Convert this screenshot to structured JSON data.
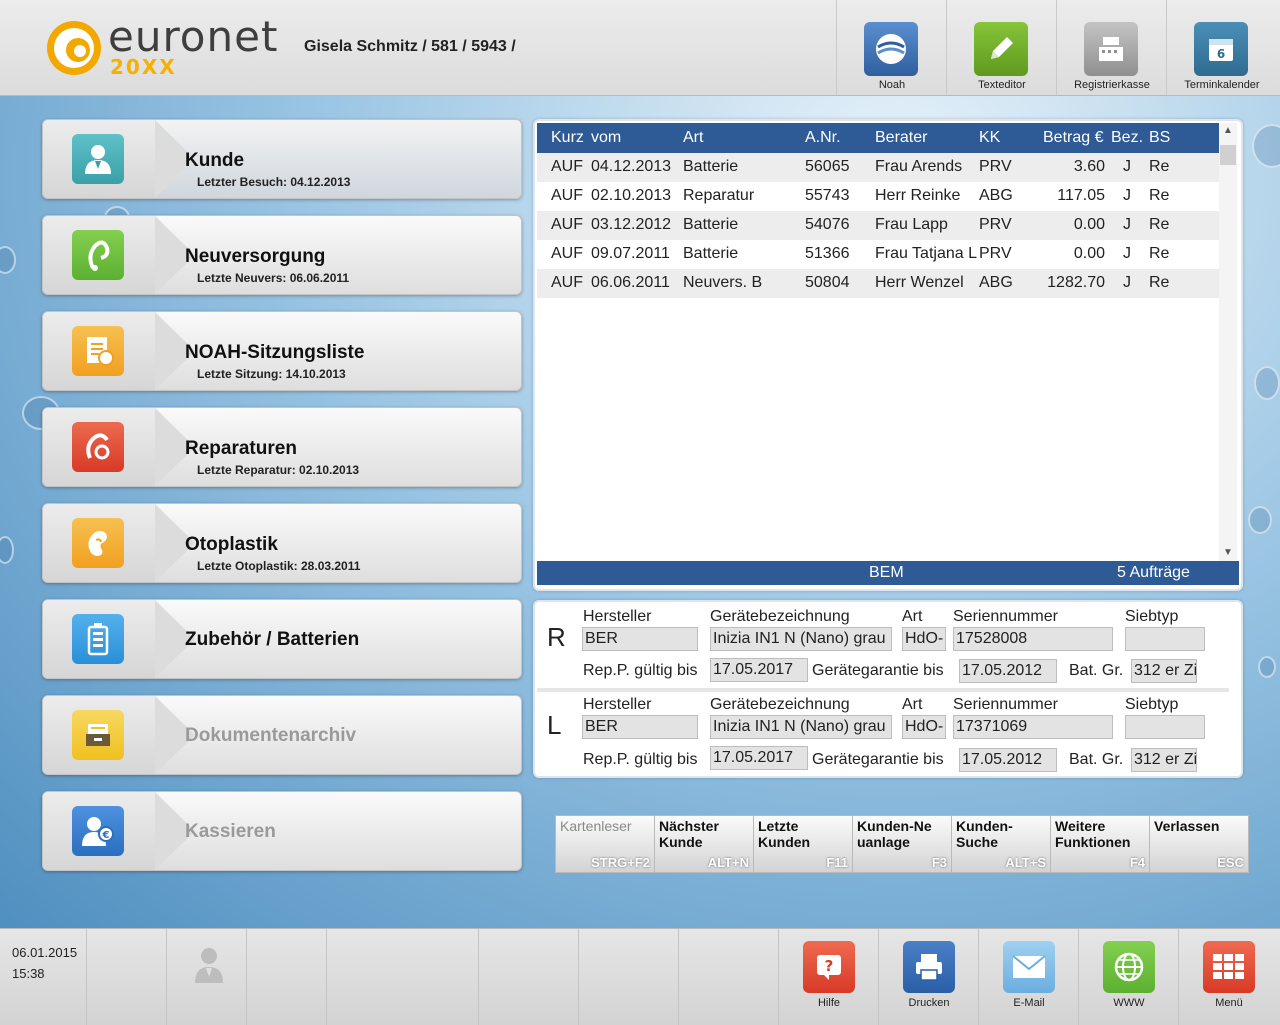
{
  "app": {
    "brand": "euronet",
    "brand_sub": "20XX",
    "customer_line": "Gisela Schmitz / 581 / 5943 /"
  },
  "toolbar": [
    {
      "label": "Noah",
      "icon": "noah-icon",
      "color": "#2f5f9e"
    },
    {
      "label": "Texteditor",
      "icon": "pencil-icon",
      "color": "#5f9a1e"
    },
    {
      "label": "Registrierkasse",
      "icon": "cash-register-icon",
      "color": "#8f8f8f"
    },
    {
      "label": "Terminkalender",
      "icon": "calendar-icon",
      "color": "#2f6b8f"
    }
  ],
  "menu": [
    {
      "title": "Kunde",
      "sub": "Letzter Besuch: 04.12.2013",
      "icon": "customer-icon",
      "color": "#3aa0a8",
      "enabled": true
    },
    {
      "title": "Neuversorgung",
      "sub": "Letzte Neuvers: 06.06.2011",
      "icon": "hearing-aid-icon",
      "color": "#5cb030",
      "enabled": true
    },
    {
      "title": "NOAH-Sitzungsliste",
      "sub": "Letzte Sitzung: 14.10.2013",
      "icon": "session-list-icon",
      "color": "#f0a020",
      "enabled": true
    },
    {
      "title": "Reparaturen",
      "sub": "Letzte Reparatur: 02.10.2013",
      "icon": "repair-icon",
      "color": "#d83a26",
      "enabled": true
    },
    {
      "title": "Otoplastik",
      "sub": "Letzte Otoplastik: 28.03.2011",
      "icon": "ear-mould-icon",
      "color": "#f0a020",
      "enabled": true
    },
    {
      "title": "Zubehör / Batterien",
      "sub": "",
      "icon": "battery-icon",
      "color": "#2a8fd8",
      "enabled": true
    },
    {
      "title": "Dokumentenarchiv",
      "sub": "",
      "icon": "archive-icon",
      "color": "#f0c020",
      "enabled": false
    },
    {
      "title": "Kassieren",
      "sub": "",
      "icon": "cashier-icon",
      "color": "#2a6fc0",
      "enabled": false
    }
  ],
  "orders": {
    "headers": {
      "kurz": "Kurz",
      "vom": "vom",
      "art": "Art",
      "anr": "A.Nr.",
      "berater": "Berater",
      "kk": "KK",
      "betrag": "Betrag €",
      "bez": "Bez.",
      "bs": "BS"
    },
    "rows": [
      {
        "kurz": "AUF",
        "vom": "04.12.2013",
        "art": "Batterie",
        "anr": "56065",
        "berater": "Frau Arends",
        "kk": "PRV",
        "betrag": "3.60",
        "bez": "J",
        "bs": "Re"
      },
      {
        "kurz": "AUF",
        "vom": "02.10.2013",
        "art": "Reparatur",
        "anr": "55743",
        "berater": "Herr Reinke",
        "kk": "ABG",
        "betrag": "117.05",
        "bez": "J",
        "bs": "Re"
      },
      {
        "kurz": "AUF",
        "vom": "03.12.2012",
        "art": "Batterie",
        "anr": "54076",
        "berater": "Frau Lapp",
        "kk": "PRV",
        "betrag": "0.00",
        "bez": "J",
        "bs": "Re"
      },
      {
        "kurz": "AUF",
        "vom": "09.07.2011",
        "art": "Batterie",
        "anr": "51366",
        "berater": "Frau Tatjana L",
        "kk": "PRV",
        "betrag": "0.00",
        "bez": "J",
        "bs": "Re"
      },
      {
        "kurz": "AUF",
        "vom": "06.06.2011",
        "art": "Neuvers. B",
        "anr": "50804",
        "berater": "Herr Wenzel",
        "kk": "ABG",
        "betrag": "1282.70",
        "bez": "J",
        "bs": "Re"
      }
    ],
    "footer_left": "BEM",
    "footer_right": "5 Aufträge"
  },
  "devices": {
    "labels": {
      "hersteller": "Hersteller",
      "geraet": "Gerätebezeichnung",
      "art": "Art",
      "serie": "Seriennummer",
      "siebtyp": "Siebtyp",
      "rep": "Rep.P. gültig bis",
      "garantie": "Gerätegarantie bis",
      "batgr": "Bat. Gr."
    },
    "right": {
      "side": "R",
      "hersteller": "BER",
      "geraet": "Inizia IN1 N (Nano) grau",
      "art": "HdO-",
      "serie": "17528008",
      "siebtyp": "",
      "rep": "17.05.2017",
      "garantie": "17.05.2012",
      "batgr": "312 er Zi"
    },
    "left": {
      "side": "L",
      "hersteller": "BER",
      "geraet": "Inizia IN1 N (Nano) grau",
      "art": "HdO-",
      "serie": "17371069",
      "siebtyp": "",
      "rep": "17.05.2017",
      "garantie": "17.05.2012",
      "batgr": "312 er Zi"
    }
  },
  "fkeys": [
    {
      "label": "Kartenleser",
      "key": "STRG+F2",
      "enabled": false
    },
    {
      "label": "Nächster Kunde",
      "key": "ALT+N",
      "enabled": true
    },
    {
      "label": "Letzte Kunden",
      "key": "F11",
      "enabled": true
    },
    {
      "label": "Kunden-Neuanlage",
      "key": "F3",
      "enabled": true
    },
    {
      "label": "Kunden-Suche",
      "key": "ALT+S",
      "enabled": true
    },
    {
      "label": "Weitere Funktionen",
      "key": "F4",
      "enabled": true
    },
    {
      "label": "Verlassen",
      "key": "ESC",
      "enabled": true
    }
  ],
  "footer": {
    "date": "06.01.2015",
    "time": "15:38",
    "buttons": [
      {
        "label": "Hilfe",
        "icon": "help-icon",
        "color": "#d83a26"
      },
      {
        "label": "Drucken",
        "icon": "printer-icon",
        "color": "#2a5fa8"
      },
      {
        "label": "E-Mail",
        "icon": "mail-icon",
        "color": "#6aaee0"
      },
      {
        "label": "WWW",
        "icon": "globe-icon",
        "color": "#5cb030"
      },
      {
        "label": "Menü",
        "icon": "menu-grid-icon",
        "color": "#d83a26"
      }
    ]
  }
}
